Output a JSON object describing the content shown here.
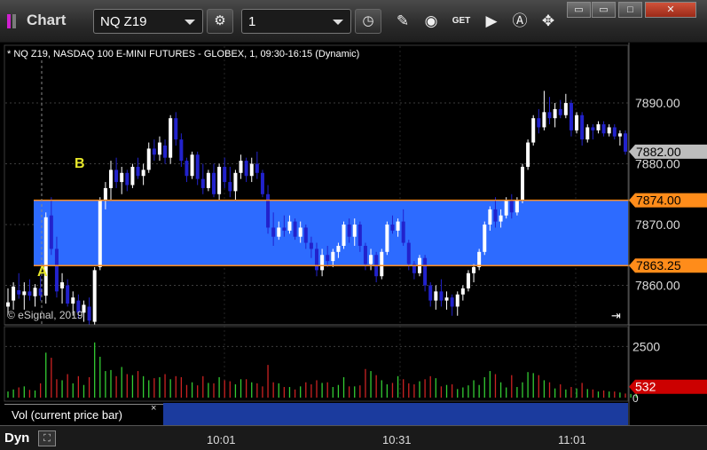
{
  "toolbar": {
    "title": "Chart",
    "symbol": "NQ Z19",
    "interval": "1",
    "icons": [
      "settings-gear-icon",
      "clock-icon",
      "pencil-draw-icon",
      "trend-icon",
      "get-data-icon",
      "play-icon",
      "alert-a-icon",
      "move-cursor-icon"
    ],
    "window_controls": [
      "restore",
      "maximize",
      "close"
    ]
  },
  "chart": {
    "header": "* NQ Z19, NASDAQ 100 E-MINI FUTURES - GLOBEX, 1, 09:30-16:15 (Dynamic)",
    "copyright": "© eSignal, 2019",
    "scroll_end_icon": "scroll-to-end-icon",
    "price_ticks": [
      "7890.00",
      "7880.00",
      "7870.00",
      "7860.00"
    ],
    "last_price": "7882.00",
    "upper_level": "7874.00",
    "lower_level": "7863.25",
    "marker_b": "B",
    "marker_a": "A",
    "volume_ticks": [
      "2500",
      "0"
    ],
    "volume_last": "532",
    "study_label": "Vol (current price bar)",
    "close_study": "×",
    "footer_mode": "Dyn",
    "time_labels": [
      "10:01",
      "10:31",
      "11:01"
    ]
  },
  "colors": {
    "up_bar": "#ffffff",
    "down_bar": "#2222cc",
    "band_fill": "#2d6bff",
    "level_line": "#ff8c1a",
    "last_price_bg": "#bdbdbd",
    "volume_last_bg": "#cc0000",
    "vol_up": "#33cc33",
    "vol_down": "#cc2222"
  },
  "chart_data": {
    "type": "candlestick",
    "title": "NQ Z19, NASDAQ 100 E-MINI FUTURES - GLOBEX, 1, 09:30-16:15 (Dynamic)",
    "ylim": [
      7853.5,
      7899.5
    ],
    "y_ticks": [
      7890,
      7880,
      7870,
      7860
    ],
    "x_ticks": [
      "10:01",
      "10:31",
      "11:01"
    ],
    "levels": [
      7874.0,
      7863.25
    ],
    "last": 7882.0,
    "ohlc": [
      [
        7856.5,
        7859.5,
        7855.2,
        7857.2
      ],
      [
        7857.5,
        7860.5,
        7856.0,
        7859.8
      ],
      [
        7859.2,
        7862.0,
        7857.8,
        7858.5
      ],
      [
        7858.4,
        7860.5,
        7856.0,
        7859.0
      ],
      [
        7859.0,
        7861.0,
        7857.5,
        7858.3
      ],
      [
        7858.2,
        7860.2,
        7856.5,
        7859.6
      ],
      [
        7859.5,
        7861.5,
        7857.5,
        7858.3
      ],
      [
        7858.3,
        7872.0,
        7857.0,
        7871.2
      ],
      [
        7871.5,
        7874.5,
        7865.0,
        7866.0
      ],
      [
        7866.0,
        7868.0,
        7858.0,
        7859.0
      ],
      [
        7859.5,
        7862.0,
        7857.0,
        7860.5
      ],
      [
        7860.0,
        7861.0,
        7856.5,
        7857.0
      ],
      [
        7857.0,
        7859.0,
        7855.0,
        7858.0
      ],
      [
        7857.5,
        7858.5,
        7854.5,
        7855.5
      ],
      [
        7855.5,
        7857.5,
        7854.0,
        7856.8
      ],
      [
        7856.5,
        7858.0,
        7853.5,
        7854.2
      ],
      [
        7854.0,
        7863.0,
        7853.5,
        7862.5
      ],
      [
        7863.0,
        7874.5,
        7862.5,
        7874.0
      ],
      [
        7874.0,
        7877.0,
        7872.5,
        7876.0
      ],
      [
        7876.0,
        7880.5,
        7874.0,
        7879.0
      ],
      [
        7879.0,
        7881.0,
        7876.0,
        7877.0
      ],
      [
        7877.0,
        7879.5,
        7875.0,
        7878.5
      ],
      [
        7878.5,
        7879.0,
        7875.5,
        7876.5
      ],
      [
        7876.5,
        7880.0,
        7876.0,
        7879.5
      ],
      [
        7879.5,
        7881.0,
        7877.5,
        7878.0
      ],
      [
        7878.0,
        7880.0,
        7876.5,
        7879.0
      ],
      [
        7879.0,
        7883.5,
        7878.5,
        7882.5
      ],
      [
        7882.5,
        7884.0,
        7880.5,
        7881.5
      ],
      [
        7881.5,
        7884.5,
        7880.5,
        7883.5
      ],
      [
        7883.0,
        7884.0,
        7880.0,
        7881.0
      ],
      [
        7881.0,
        7888.0,
        7880.0,
        7887.5
      ],
      [
        7887.5,
        7888.5,
        7883.0,
        7884.0
      ],
      [
        7884.0,
        7885.0,
        7879.5,
        7880.5
      ],
      [
        7880.5,
        7881.0,
        7877.0,
        7878.0
      ],
      [
        7878.0,
        7882.0,
        7877.5,
        7881.5
      ],
      [
        7881.5,
        7882.0,
        7876.5,
        7877.5
      ],
      [
        7877.5,
        7880.0,
        7875.0,
        7876.0
      ],
      [
        7876.0,
        7879.0,
        7875.5,
        7878.5
      ],
      [
        7878.5,
        7880.0,
        7874.5,
        7875.0
      ],
      [
        7875.0,
        7880.0,
        7874.0,
        7879.5
      ],
      [
        7879.5,
        7881.0,
        7876.0,
        7877.0
      ],
      [
        7877.0,
        7879.5,
        7874.5,
        7875.5
      ],
      [
        7875.5,
        7879.0,
        7874.0,
        7878.5
      ],
      [
        7878.5,
        7881.5,
        7877.5,
        7880.5
      ],
      [
        7880.5,
        7881.0,
        7877.0,
        7878.0
      ],
      [
        7878.0,
        7881.0,
        7877.0,
        7880.0
      ],
      [
        7880.0,
        7882.0,
        7877.5,
        7878.5
      ],
      [
        7878.5,
        7879.0,
        7874.5,
        7875.0
      ],
      [
        7875.0,
        7876.5,
        7868.5,
        7869.5
      ],
      [
        7869.5,
        7872.0,
        7866.5,
        7868.0
      ],
      [
        7868.0,
        7870.5,
        7867.5,
        7869.5
      ],
      [
        7869.5,
        7871.5,
        7868.0,
        7869.0
      ],
      [
        7869.0,
        7871.5,
        7868.5,
        7870.5
      ],
      [
        7870.5,
        7871.0,
        7867.5,
        7868.0
      ],
      [
        7868.0,
        7870.5,
        7867.0,
        7869.5
      ],
      [
        7869.5,
        7870.0,
        7866.0,
        7867.0
      ],
      [
        7867.0,
        7868.0,
        7864.5,
        7866.0
      ],
      [
        7866.0,
        7867.0,
        7861.5,
        7862.5
      ],
      [
        7862.5,
        7866.0,
        7861.5,
        7865.0
      ],
      [
        7865.0,
        7866.5,
        7863.0,
        7864.0
      ],
      [
        7864.0,
        7866.0,
        7863.0,
        7865.5
      ],
      [
        7865.5,
        7867.0,
        7864.5,
        7866.5
      ],
      [
        7866.5,
        7870.5,
        7866.0,
        7870.0
      ],
      [
        7870.0,
        7871.0,
        7867.0,
        7868.0
      ],
      [
        7868.0,
        7871.0,
        7866.5,
        7870.0
      ],
      [
        7870.0,
        7870.5,
        7865.5,
        7866.5
      ],
      [
        7866.5,
        7867.0,
        7862.5,
        7863.5
      ],
      [
        7863.5,
        7866.0,
        7862.5,
        7865.0
      ],
      [
        7865.0,
        7865.5,
        7860.5,
        7861.5
      ],
      [
        7861.5,
        7866.0,
        7861.0,
        7865.5
      ],
      [
        7865.5,
        7870.5,
        7865.0,
        7870.0
      ],
      [
        7870.0,
        7871.5,
        7868.5,
        7869.0
      ],
      [
        7869.0,
        7871.0,
        7868.0,
        7870.5
      ],
      [
        7870.5,
        7872.5,
        7866.5,
        7867.0
      ],
      [
        7867.0,
        7867.5,
        7862.5,
        7863.5
      ],
      [
        7863.5,
        7864.0,
        7861.0,
        7862.0
      ],
      [
        7862.0,
        7865.0,
        7861.5,
        7864.5
      ],
      [
        7864.5,
        7865.0,
        7859.0,
        7860.0
      ],
      [
        7860.0,
        7860.5,
        7856.5,
        7857.5
      ],
      [
        7857.5,
        7860.0,
        7856.0,
        7859.0
      ],
      [
        7859.0,
        7861.0,
        7856.5,
        7857.5
      ],
      [
        7857.5,
        7859.0,
        7856.0,
        7858.0
      ],
      [
        7858.0,
        7858.5,
        7855.0,
        7856.5
      ],
      [
        7856.5,
        7859.0,
        7855.0,
        7858.5
      ],
      [
        7858.5,
        7860.0,
        7857.5,
        7859.5
      ],
      [
        7859.5,
        7862.5,
        7859.0,
        7862.0
      ],
      [
        7862.0,
        7863.5,
        7860.5,
        7863.0
      ],
      [
        7863.0,
        7866.0,
        7862.5,
        7865.5
      ],
      [
        7865.5,
        7870.5,
        7865.0,
        7870.0
      ],
      [
        7870.0,
        7873.0,
        7869.0,
        7872.5
      ],
      [
        7872.5,
        7874.5,
        7869.5,
        7870.5
      ],
      [
        7870.5,
        7872.5,
        7869.5,
        7871.5
      ],
      [
        7871.5,
        7874.5,
        7871.0,
        7874.0
      ],
      [
        7874.0,
        7875.0,
        7871.0,
        7872.0
      ],
      [
        7872.0,
        7874.5,
        7871.5,
        7874.0
      ],
      [
        7874.0,
        7880.0,
        7873.5,
        7879.5
      ],
      [
        7879.5,
        7884.0,
        7879.0,
        7883.5
      ],
      [
        7883.5,
        7888.0,
        7883.0,
        7887.5
      ],
      [
        7887.5,
        7889.0,
        7885.0,
        7886.0
      ],
      [
        7886.0,
        7892.0,
        7885.5,
        7888.5
      ],
      [
        7888.5,
        7891.0,
        7886.5,
        7887.5
      ],
      [
        7887.5,
        7890.0,
        7886.0,
        7889.0
      ],
      [
        7889.0,
        7890.5,
        7887.5,
        7888.0
      ],
      [
        7888.0,
        7891.5,
        7887.5,
        7890.0
      ],
      [
        7890.0,
        7890.5,
        7884.5,
        7885.5
      ],
      [
        7885.5,
        7888.5,
        7885.0,
        7888.0
      ],
      [
        7888.0,
        7888.5,
        7883.0,
        7884.0
      ],
      [
        7884.0,
        7886.5,
        7883.5,
        7886.0
      ],
      [
        7886.0,
        7886.5,
        7884.0,
        7885.5
      ],
      [
        7885.5,
        7887.0,
        7885.0,
        7886.5
      ],
      [
        7886.5,
        7887.0,
        7884.5,
        7885.0
      ],
      [
        7885.0,
        7886.5,
        7884.5,
        7886.0
      ],
      [
        7886.0,
        7886.5,
        7884.0,
        7884.5
      ],
      [
        7884.5,
        7885.5,
        7883.0,
        7885.0
      ],
      [
        7885.0,
        7885.5,
        7881.5,
        7882.0
      ]
    ],
    "volume_ylim": [
      0,
      3300
    ],
    "volume": [
      300,
      400,
      500,
      550,
      380,
      350,
      700,
      2200,
      1950,
      900,
      850,
      1150,
      700,
      1050,
      620,
      1000,
      2700,
      2000,
      1300,
      1350,
      1050,
      1500,
      1150,
      1100,
      1300,
      1050,
      850,
      950,
      1000,
      1150,
      900,
      1050,
      1000,
      620,
      750,
      600,
      1050,
      720,
      700,
      1000,
      850,
      800,
      650,
      900,
      900,
      750,
      700,
      550,
      1600,
      750,
      700,
      520,
      520,
      400,
      550,
      750,
      650,
      850,
      720,
      750,
      520,
      620,
      1000,
      550,
      550,
      600,
      1400,
      1300,
      1100,
      850,
      650,
      720,
      1050,
      900,
      700,
      650,
      800,
      900,
      1050,
      950,
      550,
      620,
      650,
      420,
      500,
      600,
      850,
      620,
      1000,
      1300,
      1150,
      750,
      500,
      1100,
      520,
      750,
      1250,
      1200,
      1100,
      850,
      750,
      450,
      650,
      400,
      520,
      450,
      720,
      420,
      400,
      300,
      350,
      300,
      300,
      250,
      200,
      180,
      220
    ]
  }
}
